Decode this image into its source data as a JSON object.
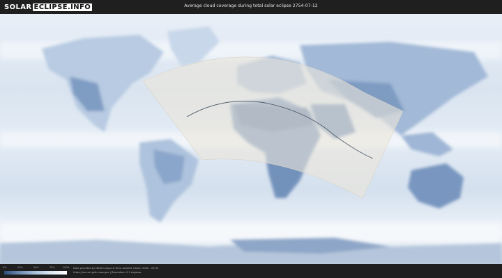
{
  "header": {
    "logo_part1": "SOLAR",
    "logo_part2": "ECLIPSE.INFO",
    "title": "Average cloud coverage during total solar eclipse 2754-07-12"
  },
  "legend": {
    "ticks": [
      "0%",
      "25%",
      "50%",
      "75%",
      "100%"
    ],
    "colors": [
      "#2e4f7a",
      "#6d8db5",
      "#a9c1dc",
      "#dfe8f2",
      "#ffffff"
    ]
  },
  "footer": {
    "credit_line1": "Data provided by NASA's Aqua & Terra satellite (Years: 2000 - 2019)",
    "credit_line2": "https://neo.sci.gsfc.nasa.gov  |  Resolution: 0.1 degrees"
  },
  "map": {
    "ocean_color": "#dfe8f2",
    "land_color": "#c9d8ea",
    "cloudless_color": "#5a76a0",
    "visibility_zone_color": "#e6e1d6",
    "eclipse_path_color": "#3a4a5c"
  }
}
